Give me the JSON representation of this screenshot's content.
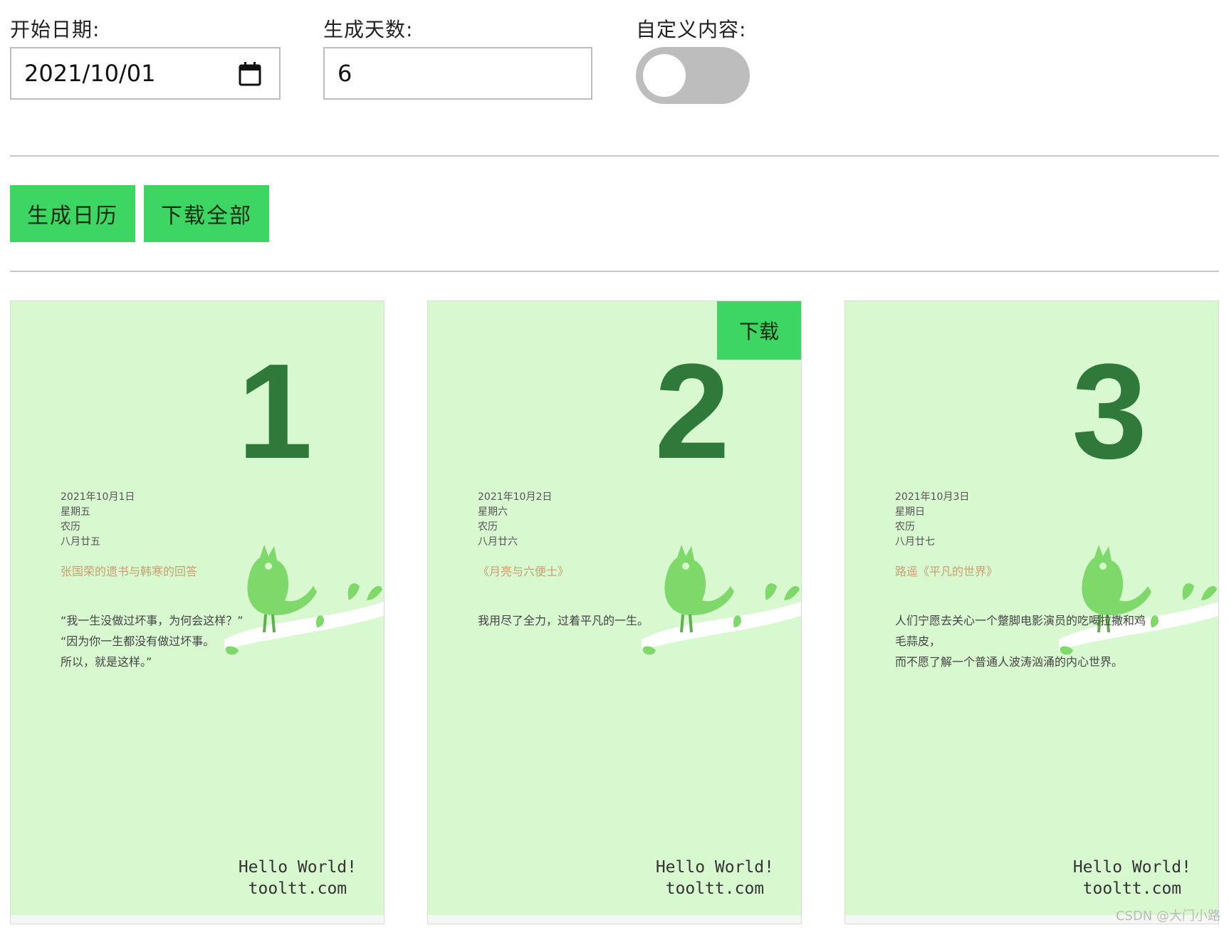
{
  "form": {
    "start_date_label": "开始日期:",
    "start_date_value": "2021/10/01",
    "days_label": "生成天数:",
    "days_value": "6",
    "custom_label": "自定义内容:",
    "custom_enabled": false
  },
  "actions": {
    "generate": "生成日历",
    "download_all": "下载全部"
  },
  "cards": [
    {
      "day": "1",
      "date": "2021年10月1日",
      "weekday": "星期五",
      "lunar_label": "农历",
      "lunar_date": "八月廿五",
      "source": "张国荣的遗书与韩寒的回答",
      "quote_lines": [
        "“我一生没做过坏事，为何会这样？”",
        "“因为你一生都没有做过坏事。",
        "所以，就是这样。”"
      ],
      "hello": "Hello World!",
      "site": "tooltt.com"
    },
    {
      "day": "2",
      "date": "2021年10月2日",
      "weekday": "星期六",
      "lunar_label": "农历",
      "lunar_date": "八月廿六",
      "source": "《月亮与六便士》",
      "quote_lines": [
        "我用尽了全力，过着平凡的一生。"
      ],
      "hello": "Hello World!",
      "site": "tooltt.com",
      "download_label": "下载"
    },
    {
      "day": "3",
      "date": "2021年10月3日",
      "weekday": "星期日",
      "lunar_label": "农历",
      "lunar_date": "八月廿七",
      "source": "路遥《平凡的世界》",
      "quote_lines": [
        "人们宁愿去关心一个蹩脚电影演员的吃喝拉撒和鸡",
        "毛蒜皮，",
        "而不愿了解一个普通人波涛汹涌的内心世界。"
      ],
      "hello": "Hello World!",
      "site": "tooltt.com"
    }
  ],
  "watermark": "CSDN @大门小路",
  "colors": {
    "accent": "#3dd662",
    "card_bg": "#d8f8d0",
    "day_number": "#2f7a3a",
    "source_text": "#c8a070",
    "toggle_off": "#bdbdbd"
  },
  "icons": {
    "calendar": "calendar-icon",
    "bird": "bird-illustration"
  }
}
